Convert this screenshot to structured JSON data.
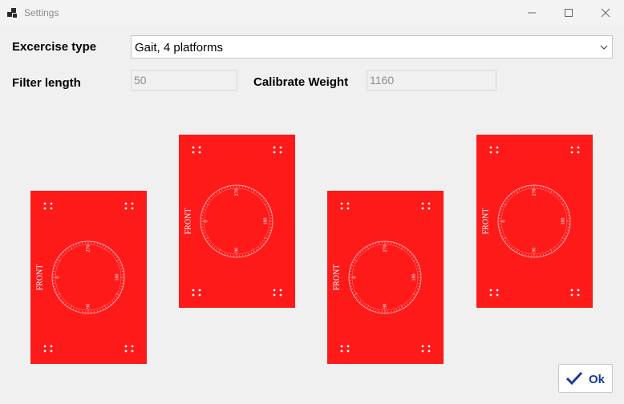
{
  "window": {
    "title": "Settings"
  },
  "form": {
    "exercise_type_label": "Excercise type",
    "exercise_type_value": "Gait, 4 platforms",
    "filter_length_label": "Filter length",
    "filter_length_value": "50",
    "calibrate_weight_label": "Calibrate Weight",
    "calibrate_weight_value": "1160"
  },
  "platform": {
    "front_label": "FRONT",
    "dial_labels": [
      "0",
      "90",
      "180",
      "270"
    ],
    "color": "#ff1a1a"
  },
  "actions": {
    "ok_label": "Ok"
  }
}
